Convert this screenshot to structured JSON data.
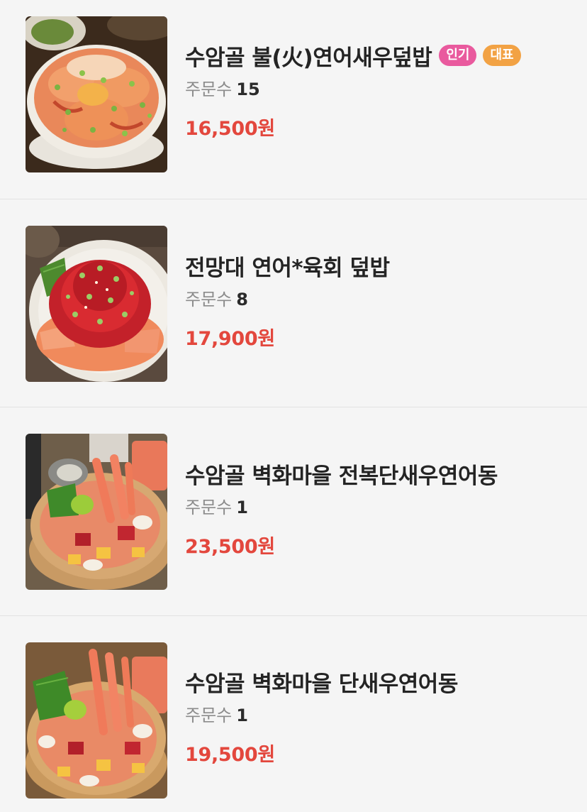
{
  "menu": {
    "items": [
      {
        "name": "수암골 불(火)연어새우덮밥",
        "badges": [
          "인기",
          "대표"
        ],
        "orders_label": "주문수",
        "orders_count": "15",
        "price": "16,500원",
        "photo_icon": "salmon-shrimp-bowl-photo"
      },
      {
        "name": "전망대 연어*육회 덮밥",
        "orders_label": "주문수",
        "orders_count": "8",
        "price": "17,900원",
        "photo_icon": "salmon-yukhoe-bowl-photo"
      },
      {
        "name": "수암골 벽화마을 전복단새우연어동",
        "orders_label": "주문수",
        "orders_count": "1",
        "price": "23,500원",
        "photo_icon": "abalone-shrimp-salmon-bowl-photo"
      },
      {
        "name": "수암골 벽화마을 단새우연어동",
        "orders_label": "주문수",
        "orders_count": "1",
        "price": "19,500원",
        "photo_icon": "shrimp-salmon-bowl-photo"
      }
    ]
  },
  "colors": {
    "background": "#f5f5f5",
    "price": "#e3473d",
    "badge_popular": "#e95a9e",
    "badge_signature": "#f2a244",
    "divider": "#e2e2e2"
  }
}
